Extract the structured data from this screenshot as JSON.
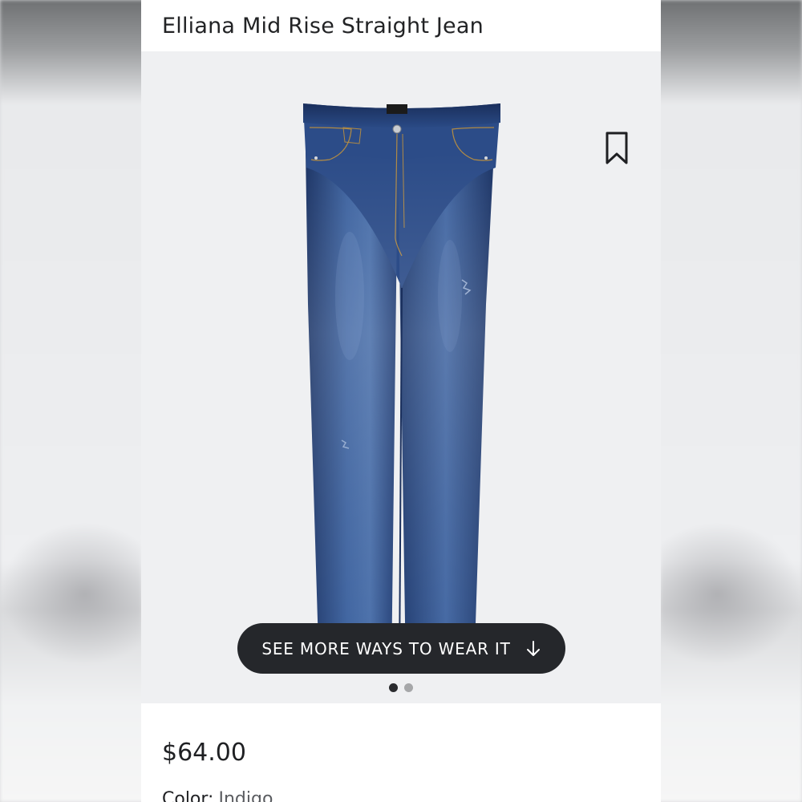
{
  "product": {
    "title": "Elliana Mid Rise Straight Jean",
    "price": "$64.00",
    "color_label": "Color:",
    "color_value": "Indigo"
  },
  "gallery": {
    "cta_label": "SEE MORE WAYS TO WEAR IT",
    "cta_icon": "arrow-down-icon",
    "bookmark_icon": "bookmark-icon",
    "image": "jeans-product-image",
    "dots": [
      {
        "active": true
      },
      {
        "active": false
      }
    ]
  },
  "colors": {
    "cta_bg": "#25272b",
    "gallery_bg": "#eff0f2",
    "denim_dark": "#1f3a6e",
    "denim_light": "#5a7cb0"
  }
}
